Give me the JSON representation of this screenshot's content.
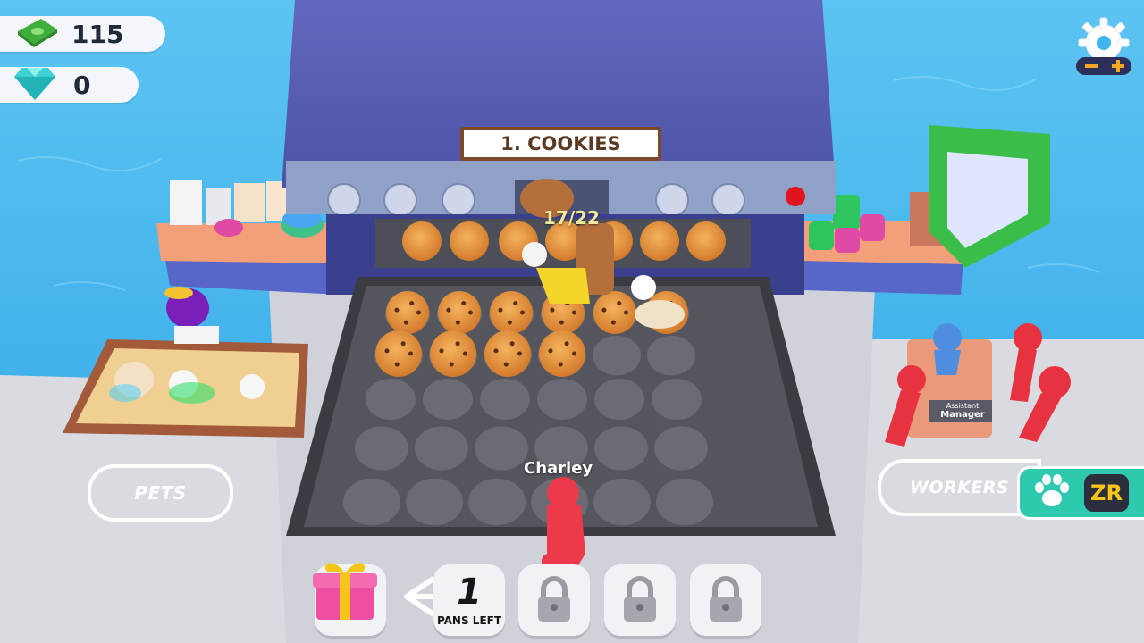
{
  "hud": {
    "cash": "115",
    "gems": "0",
    "cash_icon": "cash-stack-icon",
    "gem_icon": "diamond-icon",
    "settings_icon": "gear-icon"
  },
  "oven": {
    "sign": "1. COOKIES",
    "progress": "17/22",
    "cookies_on_tray": 17,
    "tray_capacity": 30
  },
  "player": {
    "name": "Charley"
  },
  "zones": {
    "pets_label": "PETS",
    "workers_label": "WORKERS",
    "assistant_sign_line1": "Assistant",
    "assistant_sign_line2": "Manager"
  },
  "controls": {
    "pet_button_icon": "paw-icon",
    "pet_button_key": "ZR"
  },
  "bottom_bar": {
    "pans_left_count": "1",
    "pans_left_label": "PANS LEFT",
    "gift_icon": "gift-icon",
    "locked_slots": 3
  },
  "colors": {
    "water": "#3fb4ee",
    "oven_body": "#5b5fb3",
    "tray": "#4a4b52",
    "pet_zr_button": "#2fc9b0",
    "worker_stickmen": "#e8323f",
    "player": "#ec3a4a"
  }
}
